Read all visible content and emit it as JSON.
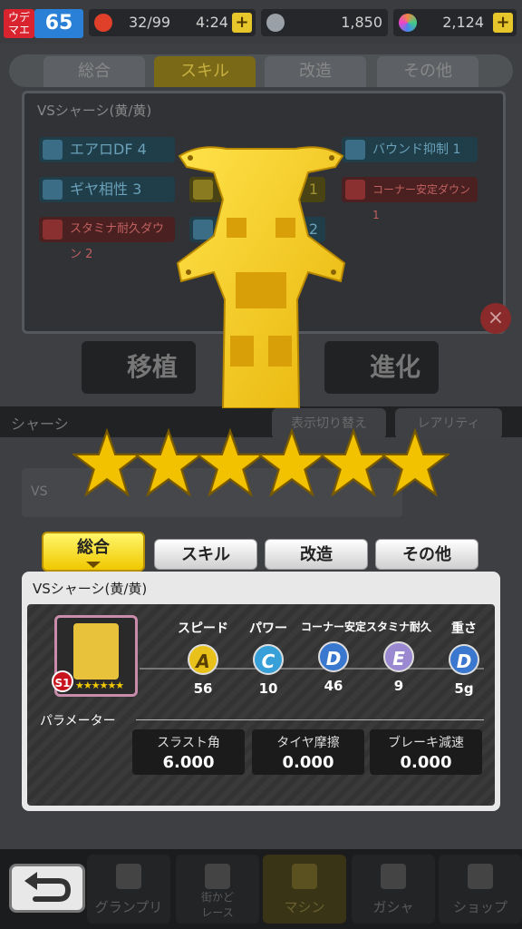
{
  "topbar": {
    "rank_badge": "ウデ\nマエ",
    "rank_level": "65",
    "stamina": "32/99",
    "stamina_time": "4:24",
    "coins": "1,850",
    "gems": "2,124",
    "plus": "+"
  },
  "background": {
    "tabs": [
      "総合",
      "スキル",
      "改造",
      "その他"
    ],
    "panel_title": "VSシャーシ(黄/黄)",
    "skills": [
      {
        "label": "エアロDF 4",
        "kind": "up"
      },
      {
        "label": "ギヤ相性 3",
        "kind": "up"
      },
      {
        "label": "スタミナ耐久ダウン 2",
        "kind": "down"
      },
      {
        "label": "バウンド抑制 1",
        "kind": "up"
      },
      {
        "label": "コーナー安定ダウン 1",
        "kind": "down"
      },
      {
        "label": "1",
        "kind": "gold"
      },
      {
        "label": "2",
        "kind": "up"
      }
    ],
    "actions": [
      "移植",
      "進化"
    ],
    "section_label": "シャーシ",
    "sort_buttons": [
      "表示切り替え",
      "レアリティ"
    ],
    "list_item": "VS"
  },
  "stars": {
    "count": 6,
    "color": "#f2c200"
  },
  "tabs": {
    "overall": "総合",
    "skill": "スキル",
    "mod": "改造",
    "other": "その他",
    "active": "overall"
  },
  "detail": {
    "title": "VSシャーシ(黄/黄)",
    "thumb_badge": "S1",
    "thumb_stars": "★★★★★★",
    "stats": [
      {
        "name": "スピード",
        "grade": "A",
        "value": "56",
        "color": "#e8c21a"
      },
      {
        "name": "パワー",
        "grade": "C",
        "value": "10",
        "color": "#38a0d8"
      },
      {
        "name": "コーナー安定",
        "grade": "D",
        "value": "46",
        "color": "#3a78d0"
      },
      {
        "name": "スタミナ耐久",
        "grade": "E",
        "value": "9",
        "color": "#9a88d0"
      },
      {
        "name": "重さ",
        "grade": "D",
        "value": "5g",
        "color": "#3a78d0"
      }
    ],
    "params_label": "パラメーター",
    "params": [
      {
        "label": "スラスト角",
        "value": "6.000"
      },
      {
        "label": "タイヤ摩擦",
        "value": "0.000"
      },
      {
        "label": "ブレーキ減速",
        "value": "0.000"
      }
    ]
  },
  "nav": {
    "items": [
      "グランプリ",
      "街かど\nレース",
      "マシン",
      "ガシャ",
      "ショップ"
    ],
    "active": "マシン"
  },
  "colors": {
    "accent": "#f0c800",
    "chassis": "#f2c318"
  }
}
